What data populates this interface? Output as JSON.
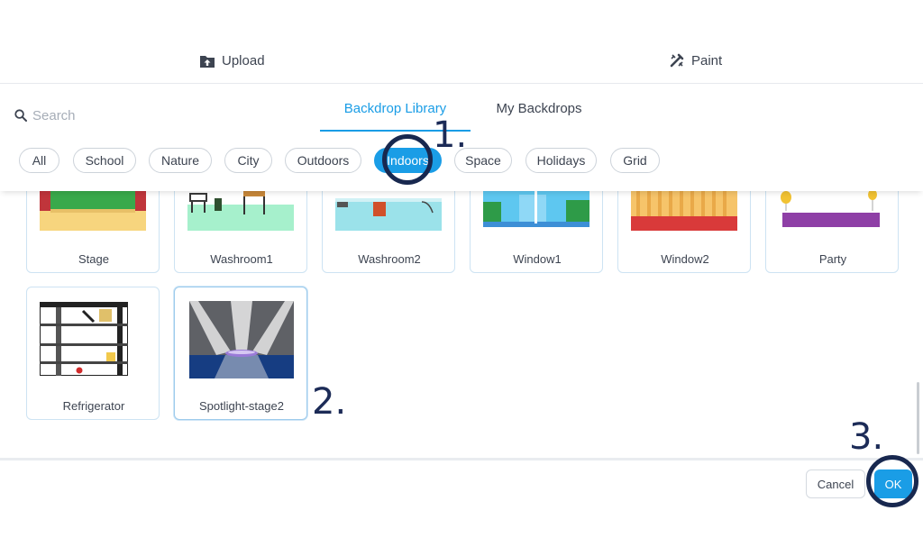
{
  "header": {
    "upload_label": "Upload",
    "paint_label": "Paint",
    "upload_icon": "upload-icon",
    "paint_icon": "paint-brush-icon"
  },
  "search": {
    "placeholder": "Search",
    "value": ""
  },
  "tabs": [
    {
      "label": "Backdrop Library",
      "active": true
    },
    {
      "label": "My Backdrops",
      "active": false
    }
  ],
  "categories": [
    {
      "label": "All"
    },
    {
      "label": "School"
    },
    {
      "label": "Nature"
    },
    {
      "label": "City"
    },
    {
      "label": "Outdoors"
    },
    {
      "label": "Indoors",
      "active": true
    },
    {
      "label": "Space"
    },
    {
      "label": "Holidays"
    },
    {
      "label": "Grid"
    }
  ],
  "backdrops": [
    {
      "name": "Stage"
    },
    {
      "name": "Washroom1"
    },
    {
      "name": "Washroom2"
    },
    {
      "name": "Window1"
    },
    {
      "name": "Window2"
    },
    {
      "name": "Party"
    },
    {
      "name": "Refrigerator"
    },
    {
      "name": "Spotlight-stage2",
      "selected": true
    }
  ],
  "footer": {
    "cancel_label": "Cancel",
    "ok_label": "OK"
  },
  "annotations": {
    "step1": "1.",
    "step2": "2.",
    "step3": "3."
  },
  "colors": {
    "accent": "#1a9de6",
    "annotation": "#1c2b57"
  }
}
